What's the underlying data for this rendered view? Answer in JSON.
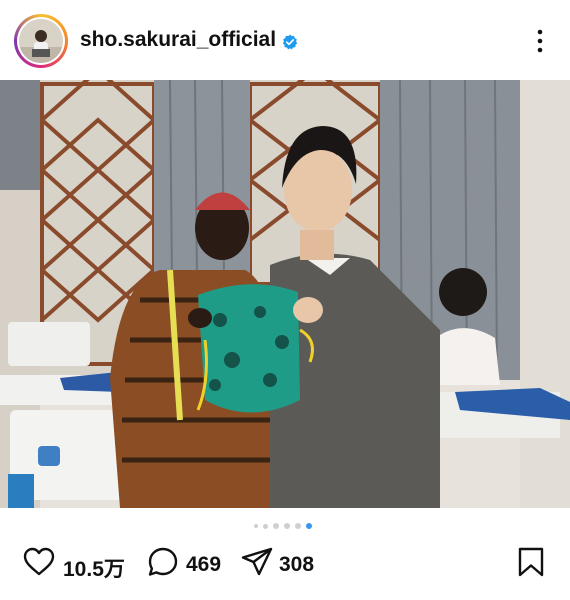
{
  "post": {
    "username": "sho.sakurai_official",
    "verified": true,
    "image_alt": "Two people holding a green patterned drawstring bag in a sewing workshop",
    "carousel": {
      "total": 6,
      "active_index": 5
    }
  },
  "stats": {
    "likes": "10.5万",
    "comments": "469",
    "shares": "308"
  },
  "icons": {
    "verified": "verified-badge-icon",
    "more": "more-options-icon",
    "like": "heart-icon",
    "comment": "comment-icon",
    "share": "share-icon",
    "save": "bookmark-icon"
  },
  "colors": {
    "verified": "#1d9bf0",
    "active_dot": "#3797f0",
    "inactive_dot": "#cfcfcf"
  }
}
